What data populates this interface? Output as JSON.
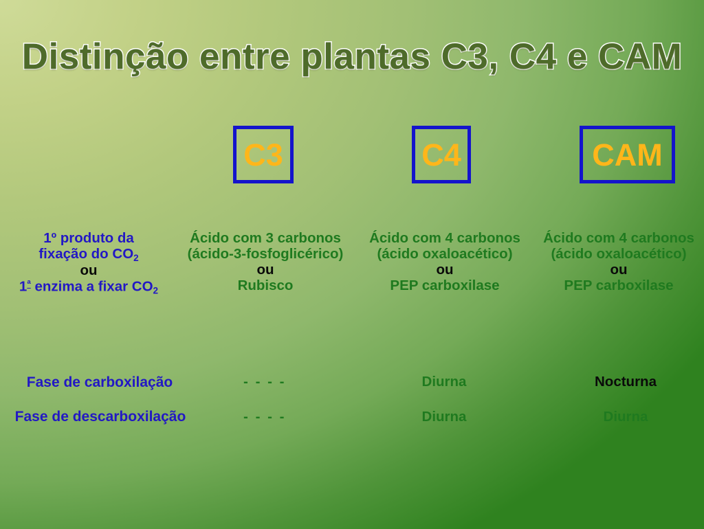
{
  "slide": {
    "title": "Distinção entre plantas  C3, C4 e CAM",
    "background": {
      "light": "#cfdb98",
      "dark": "#2f821f"
    },
    "accent_colors": {
      "title_fill": "#4e6b2a",
      "title_outline": "#ffffff",
      "box_border": "#1414cc",
      "box_text": "#ffb61a",
      "blue_text": "#2218c4",
      "green_text": "#1f7a1f",
      "black_text": "#0a0a0a"
    }
  },
  "headers": {
    "c3": "C3",
    "c4": "C4",
    "cam": "CAM"
  },
  "rows": {
    "product": {
      "label_line1": "1º produto da",
      "label_line2_pre": "fixação do CO",
      "label_line2_sub": "2",
      "label_or": "ou",
      "label_line3_pre": "1",
      "label_line3_ord": "ª",
      "label_line3_mid": " enzima a fixar CO",
      "label_line3_sub": "2",
      "c3_line1": "Ácido com 3 carbonos",
      "c3_line2": "(ácido-3-fosfoglicérico)",
      "c3_or": "ou",
      "c3_line3": "Rubisco",
      "c4_line1": "Ácido com 4 carbonos",
      "c4_line2": "(ácido oxaloacético)",
      "c4_or": "ou",
      "c4_line3": "PEP carboxilase",
      "cam_line1": "Ácido com 4 carbonos",
      "cam_line2": "(ácido oxaloacético)",
      "cam_or": "ou",
      "cam_line3": "PEP carboxilase"
    },
    "carboxylation": {
      "label": "Fase de carboxilação",
      "c3": "- - - -",
      "c4": "Diurna",
      "cam": "Nocturna"
    },
    "decarboxylation": {
      "label": "Fase de descarboxilação",
      "c3": "- - - -",
      "c4": "Diurna",
      "cam": "Diurna"
    }
  }
}
